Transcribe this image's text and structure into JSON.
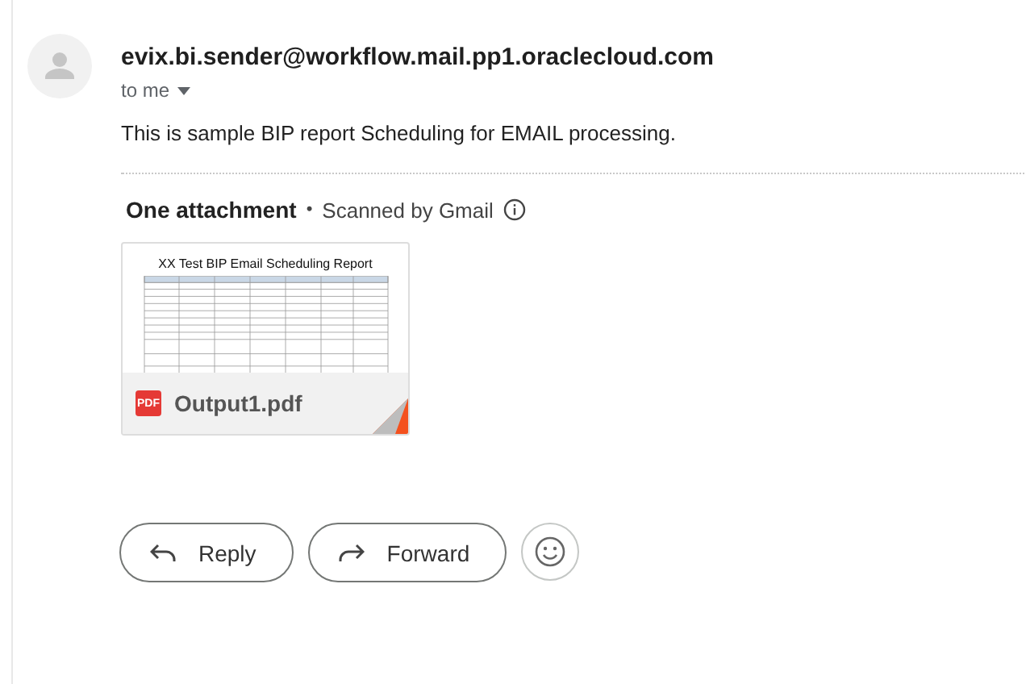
{
  "message": {
    "sender": "evix.bi.sender@workflow.mail.pp1.oraclecloud.com",
    "recipient": "to me",
    "body": "This is sample BIP report Scheduling for EMAIL processing."
  },
  "attachments_header": {
    "title": "One attachment",
    "separator": "•",
    "scan_note": "Scanned by Gmail"
  },
  "attachments": [
    {
      "preview_title": "XX Test BIP Email Scheduling Report",
      "file_type": "PDF",
      "filename": "Output1.pdf"
    }
  ],
  "actions": [
    {
      "kind": "reply",
      "label": "Reply"
    },
    {
      "kind": "forward",
      "label": "Forward"
    },
    {
      "kind": "emoji"
    }
  ]
}
